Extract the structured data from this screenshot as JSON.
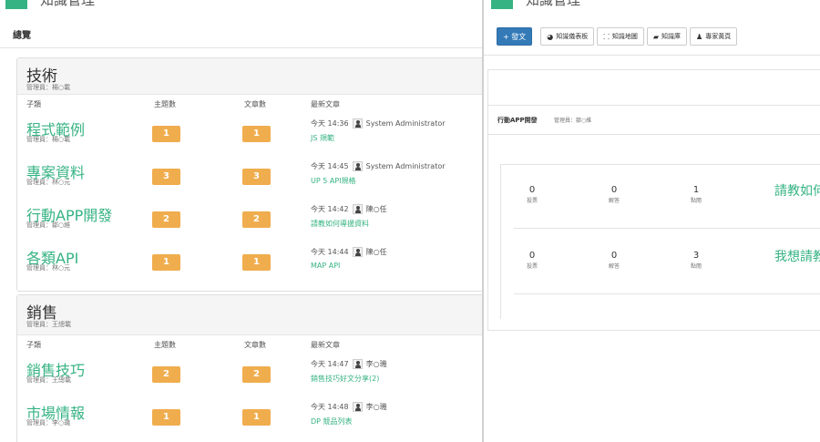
{
  "left": {
    "app_title": "知識管理",
    "overview_label": "總覽",
    "columns": {
      "sub": "子類",
      "topics": "主題數",
      "articles": "文章數",
      "latest": "最新文章"
    },
    "categories": [
      {
        "title": "技術",
        "admin": "管理員：楊○載",
        "rows": [
          {
            "name": "程式範例",
            "admin": "管理員：楊○載",
            "topics": "1",
            "articles": "1",
            "time": "今天 14:36",
            "user": "System Administrator",
            "article": "JS 規範"
          },
          {
            "name": "專案資料",
            "admin": "管理員：林○元",
            "topics": "3",
            "articles": "3",
            "time": "今天 14:45",
            "user": "System Administrator",
            "article": "UP 5 API規格"
          },
          {
            "name": "行動APP開發",
            "admin": "管理員：鄒○維",
            "topics": "2",
            "articles": "2",
            "time": "今天 14:42",
            "user": "陳○任",
            "article": "請教如何導援資料"
          },
          {
            "name": "各類API",
            "admin": "管理員：林○元",
            "topics": "1",
            "articles": "1",
            "time": "今天 14:44",
            "user": "陳○任",
            "article": "MAP API"
          }
        ]
      },
      {
        "title": "銷售",
        "admin": "管理員：王總載",
        "rows": [
          {
            "name": "銷售技巧",
            "admin": "管理員：王總載",
            "topics": "2",
            "articles": "2",
            "time": "今天 14:47",
            "user": "李○璣",
            "article": "銷售技巧好文分享(2)"
          },
          {
            "name": "市場情報",
            "admin": "管理員：李○璣",
            "topics": "1",
            "articles": "1",
            "time": "今天 14:48",
            "user": "李○璣",
            "article": "DP 競品列表"
          }
        ]
      }
    ]
  },
  "right": {
    "app_title": "知識管理",
    "buttons": {
      "post": "+ 發文",
      "dashboard": "知識儀表板",
      "map": "知識地圖",
      "library": "知識庫",
      "experts": "專家黃頁"
    },
    "sub_title": "行動APP開發",
    "sub_admin": "管理員：鄒○維",
    "questions": [
      {
        "votes": "0",
        "votes_label": "投票",
        "answers": "0",
        "answers_label": "解答",
        "views": "1",
        "views_label": "點閱",
        "title": "請教如何導"
      },
      {
        "votes": "0",
        "votes_label": "投票",
        "answers": "0",
        "answers_label": "解答",
        "views": "3",
        "views_label": "點閱",
        "title": "我想請教阿"
      }
    ]
  }
}
